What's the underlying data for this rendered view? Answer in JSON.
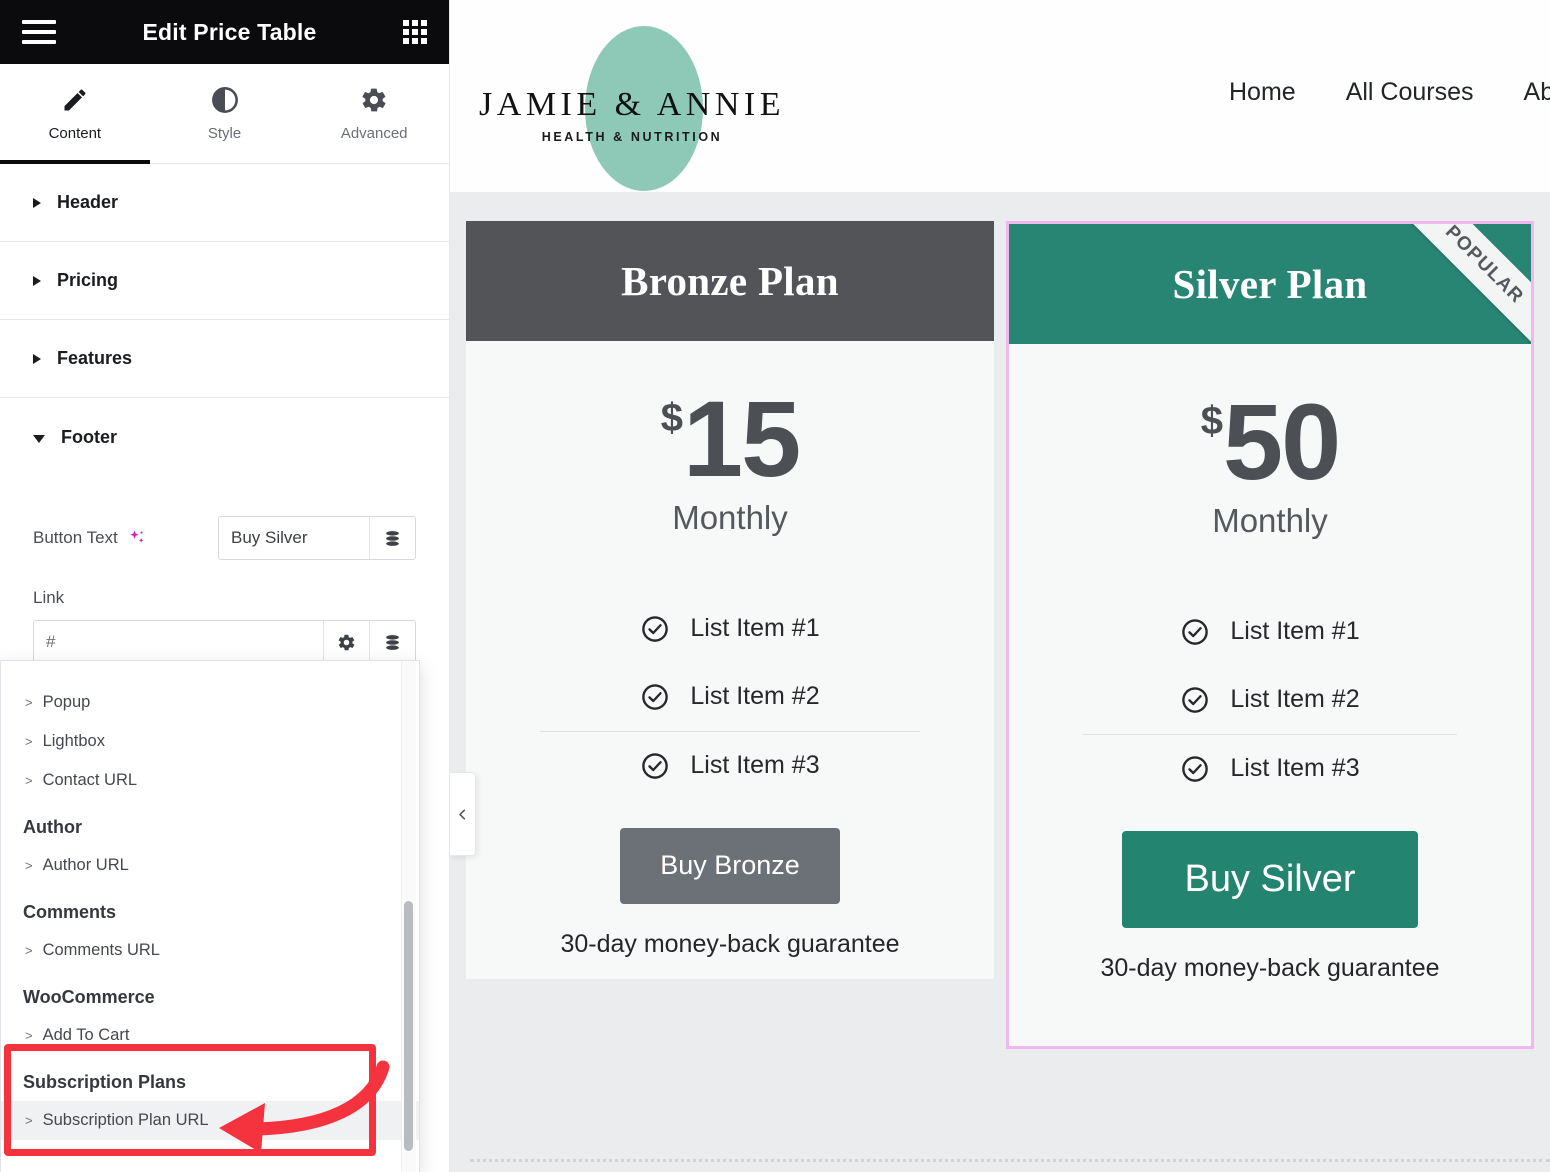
{
  "panel": {
    "title": "Edit Price Table",
    "menu_icon": "hamburger-icon",
    "apps_icon": "grid-apps-icon",
    "tabs": [
      {
        "label": "Content",
        "icon": "pencil-icon",
        "active": true
      },
      {
        "label": "Style",
        "icon": "contrast-icon",
        "active": false
      },
      {
        "label": "Advanced",
        "icon": "gear-icon",
        "active": false
      }
    ],
    "sections": [
      {
        "label": "Header",
        "open": false
      },
      {
        "label": "Pricing",
        "open": false
      },
      {
        "label": "Features",
        "open": false
      },
      {
        "label": "Footer",
        "open": true
      }
    ],
    "footer_controls": {
      "button_text_label": "Button Text",
      "ai_icon": "ai-sparkle-icon",
      "button_text_value": "Buy Silver",
      "dynamic_icon": "database-dynamic-icon",
      "link_label": "Link",
      "link_placeholder": "#",
      "link_value": "",
      "link_settings_icon": "gear-icon"
    },
    "dropdown": {
      "items": [
        {
          "type": "item",
          "label": "Popup"
        },
        {
          "type": "item",
          "label": "Lightbox"
        },
        {
          "type": "item",
          "label": "Contact URL"
        },
        {
          "type": "group",
          "label": "Author"
        },
        {
          "type": "item",
          "label": "Author URL"
        },
        {
          "type": "group",
          "label": "Comments"
        },
        {
          "type": "item",
          "label": "Comments URL"
        },
        {
          "type": "group",
          "label": "WooCommerce"
        },
        {
          "type": "item",
          "label": "Add To Cart"
        },
        {
          "type": "group",
          "label": "Subscription Plans"
        },
        {
          "type": "item",
          "label": "Subscription Plan URL",
          "highlighted": true
        }
      ],
      "chevron": ">"
    },
    "collapse_icon": "chevron-left-icon",
    "annotation_color": "#f5333f"
  },
  "site": {
    "logo": {
      "name": "JAMIE & ANNIE",
      "tagline": "HEALTH & NUTRITION",
      "blob_color": "#8ec9b7"
    },
    "nav": [
      {
        "label": "Home"
      },
      {
        "label": "All Courses"
      },
      {
        "label": "Abo"
      }
    ]
  },
  "plans": [
    {
      "id": "bronze",
      "title": "Bronze Plan",
      "header_color": "#525457",
      "currency": "$",
      "amount": "15",
      "period": "Monthly",
      "features": [
        "List Item #1",
        "List Item #2",
        "List Item #3"
      ],
      "cta_label": "Buy Bronze",
      "cta_color": "#6c7077",
      "guarantee": "30-day money-back guarantee",
      "ribbon": null,
      "selected": false
    },
    {
      "id": "silver",
      "title": "Silver Plan",
      "header_color": "#288573",
      "currency": "$",
      "amount": "50",
      "period": "Monthly",
      "features": [
        "List Item #1",
        "List Item #2",
        "List Item #3"
      ],
      "cta_label": "Buy Silver",
      "cta_color": "#23856f",
      "guarantee": "30-day money-back guarantee",
      "ribbon": "POPULAR",
      "selected": true,
      "selection_color": "#f0b8ef"
    }
  ]
}
